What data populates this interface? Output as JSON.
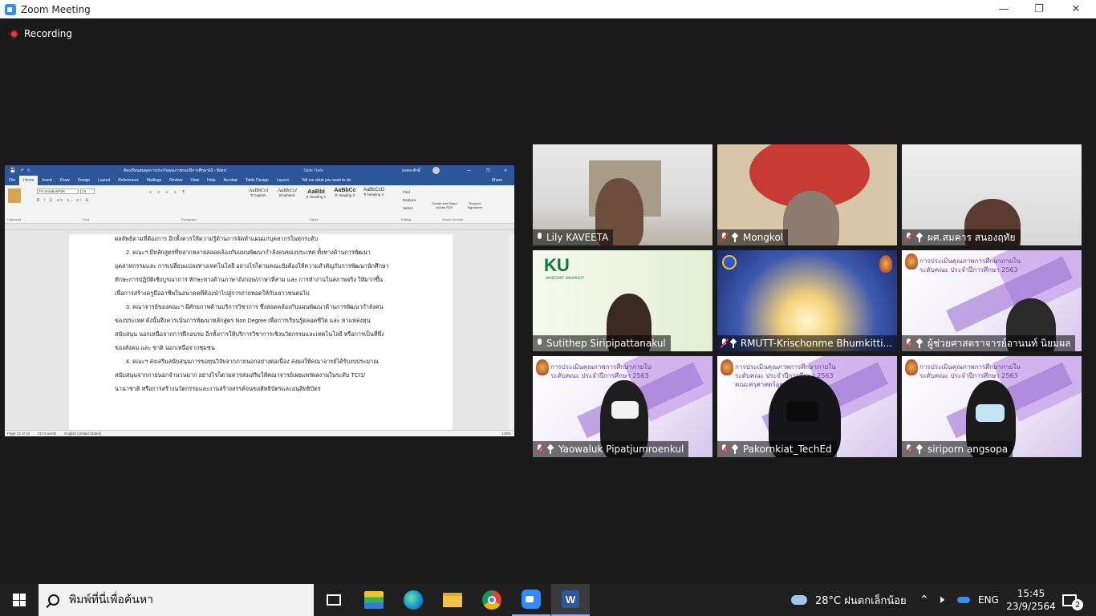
{
  "window": {
    "title": "Zoom Meeting"
  },
  "recording": {
    "label": "Recording"
  },
  "shared_screen": {
    "title": "ห้องเรียนสมดุลการประกันคุณภาพรอบปีการศึกษา63 - Word",
    "table_tools": "Table Tools",
    "user": "มงคล ศักดิ์",
    "tell_me": "Tell me what you want to do",
    "share": "Share",
    "tabs": [
      "File",
      "Home",
      "Insert",
      "Draw",
      "Design",
      "Layout",
      "References",
      "Mailings",
      "Review",
      "View",
      "Help",
      "Acrobat",
      "Table Design",
      "Layout"
    ],
    "font_name": "TH SarabunPSK",
    "font_size": "14",
    "styles": [
      "AaBbCcI",
      "AaBbCcI",
      "AaBbI",
      "AaBbCc",
      "AaBbCcD"
    ],
    "style_names": [
      "¶ Caption",
      "Emphasis",
      "¶ Heading 1",
      "¶ Heading 3",
      "¶ Heading 4"
    ],
    "groups": [
      "Clipboard",
      "Font",
      "Paragraph",
      "Styles",
      "Editing",
      "Adobe Acrobat"
    ],
    "editing": [
      "Find",
      "Replace",
      "Select"
    ],
    "acrobat": [
      "Create and Share Adobe PDF",
      "Request Signatures"
    ],
    "paragraphs": [
      "ผลลัพธ์ตามที่ต้องการ  อีกทั้งควรให้ความรู้ด้านการจัดทำแผนแก่บุคลากรในทุกระดับ",
      "2.   คณะฯ มีหลักสูตรที่หลากหลายสอดคล้องกับแผนพัฒนากำลังคนของประเทศ ทั้งทางด้านการพัฒนา",
      "อุตสาหกรรมและ การเปลี่ยนแปลงทางเทคโนโลยี อย่างไรก็ตามคณะยังต้องให้ความสำคัญกับการพัฒนานักศึกษา",
      "ทักษะการปฏิบัติเชิงบูรณาการ ทักษะทางด้านภาษาอังกฤษ/ภาษาที่สาม และ การทำงานในสภาพจริง ให้มากขึ้น",
      "เพื่อการสร้างครูมืออาชีพในอนาคตที่ต้องนำไปสู่การถ่ายทอดให้กับเยาวชนต่อไป",
      "3.   คณาจารย์ของคณะฯ มีศักยภาพด้านบริการวิชาการ ซึ่งสอดคล้องกับแผนพัฒนาด้านการพัฒนากำลังคน",
      "ของประเทศ ดังนั้นจึงควรเน้นการพัฒนาหลักสูตร Non Degree เพื่อการเรียนรู้ตลอดชีวิต และ หาแหล่งทุน",
      "สนับสนุน นอกเหนือจากการฝึกอบรม อีกทั้งการให้บริการวิชาการเชิงนวัตกรรมและเทคโนโลยี หรือการเป็นที่พึ่ง",
      "ของสังคม และ ชาติ นอกเหนือจากชุมชน",
      "4.   คณะฯ ส่งเสริมสนับสนุนการขอทุนวิจัยจากภายนอกอย่างต่อเนื่อง ส่งผลให้คณาจารย์ได้รับงบประมาณ",
      "สนับสนุนจากภายนอกจำนวนมาก อย่างไรก็ตามควรส่งเสริมให้คณาจารย์เผยแพร่ผลงานในระดับ TCI1/",
      "นานาชาติ หรือการสร้างนวัตกรรมและงานสร้างสรรค์จนขอสิทธิบัตรและอนุสิทธิบัตร"
    ],
    "status": {
      "page": "Page 12 of 15",
      "words": "3174 words",
      "lang": "English (United States)",
      "zoom": "130%"
    }
  },
  "participants": [
    {
      "name": "Lily KAVEETA",
      "muted": false
    },
    {
      "name": "Mongkol",
      "muted": true
    },
    {
      "name": "ผศ.สมคาร  สนองฤทัย",
      "muted": true
    },
    {
      "name": "Sutithep Siripipattanakul",
      "muted": false,
      "ku": "KU",
      "ku_sub": "KASETSART UNIVERSITY"
    },
    {
      "name": "RMUTT-Krischonme Bhumkitti...",
      "muted": true
    },
    {
      "name": "ผู้ช่วยศาสตราจารย์อานนท์ นิยมผล",
      "muted": true
    },
    {
      "name": "Yaowaluk Pipatjumroenkul",
      "muted": true
    },
    {
      "name": "Pakornkiat_TechEd",
      "muted": true
    },
    {
      "name": "siriporn angsopa",
      "muted": true
    }
  ],
  "slide_text": {
    "line1": "การประเมินคุณภาพการศึกษาภายใน",
    "line2": "ระดับคณะ ประจำปีการศึกษา 2563",
    "line3": "คณะครุศาสตร์อุตสาหกรรม"
  },
  "taskbar": {
    "search_placeholder": "พิมพ์ที่นี่เพื่อค้นหา",
    "weather": "28°C  ฝนตกเล็กน้อย",
    "lang": "ENG",
    "time": "15:45",
    "date": "23/9/2564",
    "notifications": "2"
  },
  "colors": {
    "word_blue": "#2b579a",
    "zoom_blue": "#2d8cff",
    "muted_red": "#e53935"
  }
}
